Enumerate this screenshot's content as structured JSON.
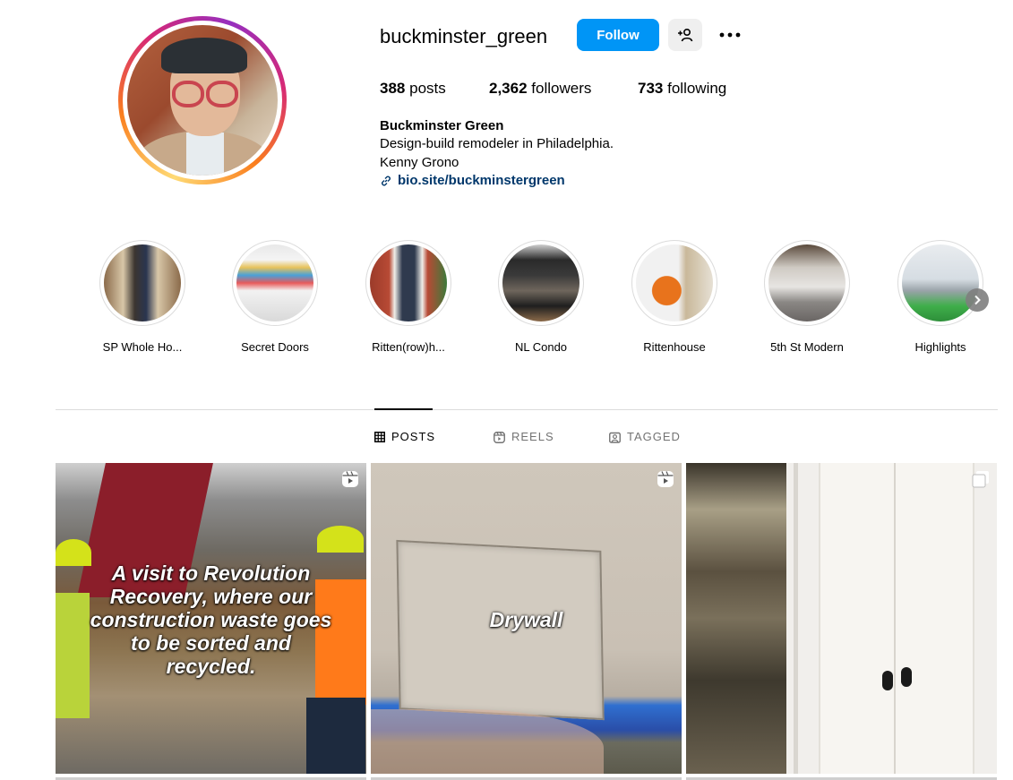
{
  "profile": {
    "username": "buckminster_green",
    "follow_label": "Follow",
    "stats": {
      "posts_count": "388",
      "posts_label": "posts",
      "followers_count": "2,362",
      "followers_label": "followers",
      "following_count": "733",
      "following_label": "following"
    },
    "full_name": "Buckminster Green",
    "bio_lines": [
      "Design-build remodeler in Philadelphia.",
      "Kenny Grono"
    ],
    "link": "bio.site/buckminstergreen"
  },
  "highlights": [
    {
      "label": "SP Whole Ho..."
    },
    {
      "label": "Secret Doors"
    },
    {
      "label": "Ritten(row)h..."
    },
    {
      "label": "NL Condo"
    },
    {
      "label": "Rittenhouse"
    },
    {
      "label": "5th St Modern"
    },
    {
      "label": "Highlights"
    }
  ],
  "tabs": [
    {
      "label": "POSTS",
      "active": true
    },
    {
      "label": "REELS",
      "active": false
    },
    {
      "label": "TAGGED",
      "active": false
    }
  ],
  "posts": [
    {
      "caption": "A visit to Revolution Recovery, where our construction waste goes to be sorted and recycled.",
      "type": "reel"
    },
    {
      "caption": "Drywall",
      "type": "reel"
    },
    {
      "caption": "",
      "type": "carousel"
    }
  ],
  "colors": {
    "follow_button": "#0095f6",
    "link": "#00376b",
    "secondary_button": "#efefef"
  }
}
